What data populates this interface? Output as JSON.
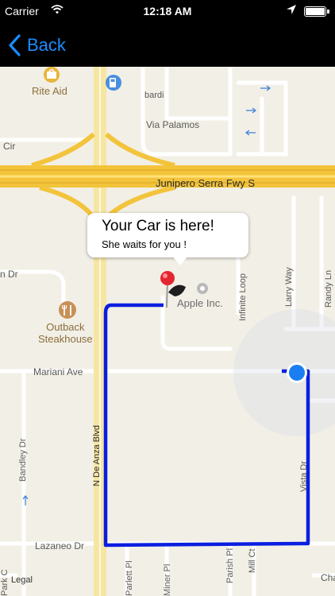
{
  "status_bar": {
    "carrier": "Carrier",
    "time": "12:18 AM"
  },
  "nav": {
    "back_label": "Back"
  },
  "map": {
    "callout": {
      "title": "Your Car is here!",
      "subtitle": "She waits for you !"
    },
    "pois": {
      "rite_aid": "Rite Aid",
      "outback": "Outback\nSteakhouse",
      "apple": "Apple Inc."
    },
    "roads": {
      "via_palamos": "Via Palamos",
      "bardi": "bardi",
      "cir": "Cir",
      "junipero": "Junipero Serra Fwy S",
      "n_dr": "n Dr",
      "infinite_loop": "Infinite Loop",
      "larry_way": "Larry Way",
      "randy_ln": "Randy Ln",
      "mariani": "Mariani Ave",
      "bandley": "Bandley Dr",
      "n_de_anza": "N De Anza Blvd",
      "vista": "Vista Dr",
      "lazaneo": "Lazaneo Dr",
      "parlett": "Parlett Pl",
      "miner": "Miner Pl",
      "parish": "Parish Pl",
      "mill": "Mill Ct",
      "park": "Park C",
      "cha": "Cha"
    },
    "legal": "Legal"
  },
  "colors": {
    "route": "#0a1ee0",
    "user_location": "#1a7ef0",
    "freeway": "#f3c43b",
    "pin": "#e3262f"
  }
}
